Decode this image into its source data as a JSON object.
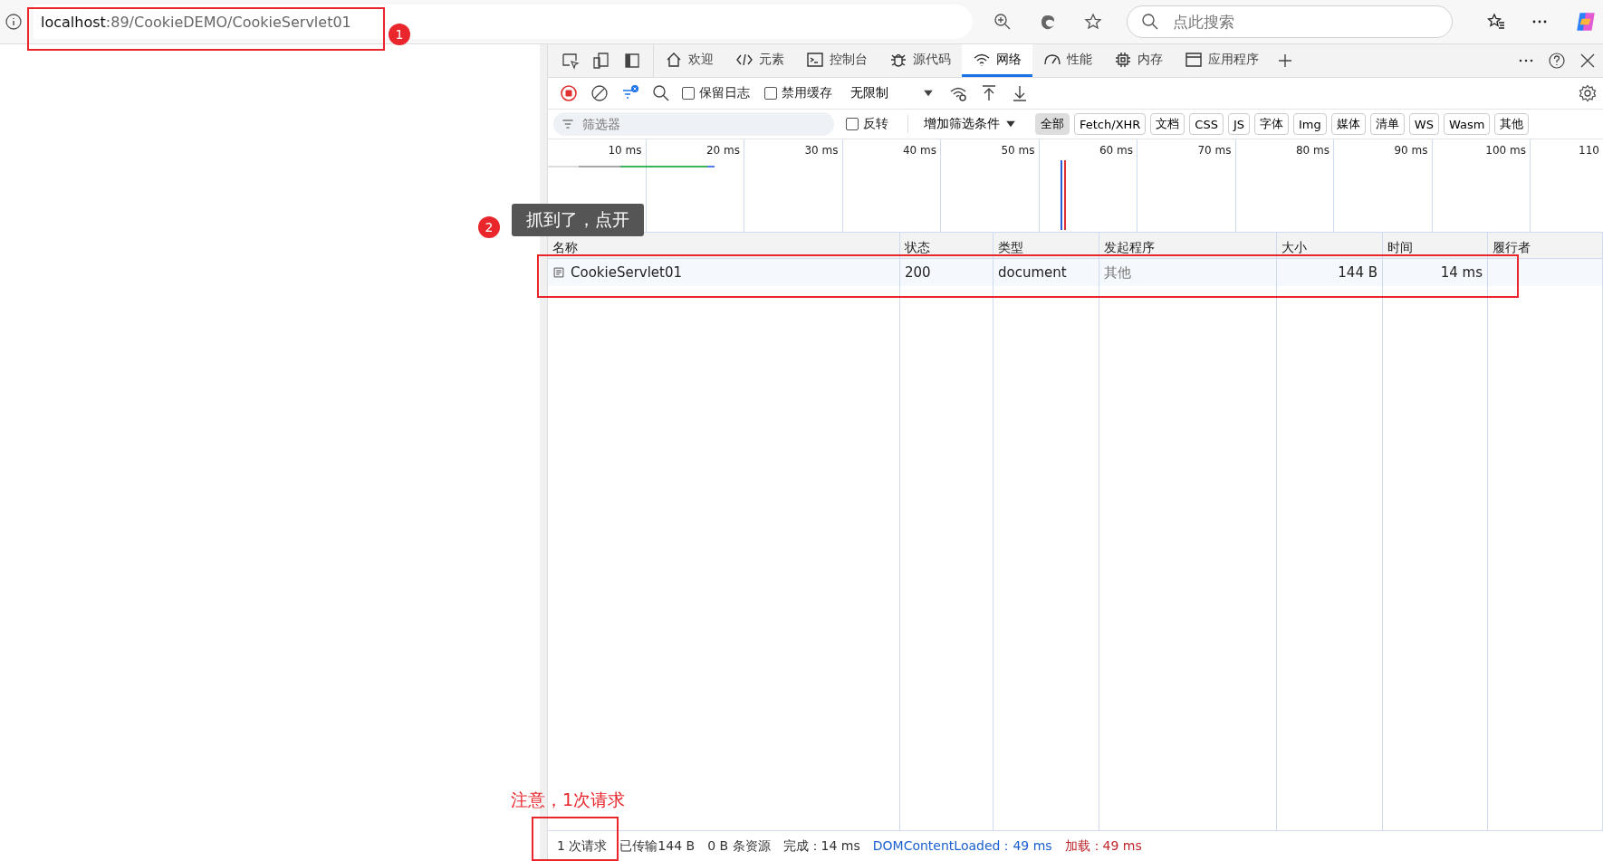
{
  "address_bar": {
    "host": "localhost",
    "path": ":89/CookieDEMO/CookieServlet01"
  },
  "search": {
    "placeholder": "点此搜索"
  },
  "devtools": {
    "tabs": [
      {
        "label": "欢迎",
        "selected": false
      },
      {
        "label": "元素",
        "selected": false
      },
      {
        "label": "控制台",
        "selected": false
      },
      {
        "label": "源代码",
        "selected": false
      },
      {
        "label": "网络",
        "selected": true
      },
      {
        "label": "性能",
        "selected": false
      },
      {
        "label": "内存",
        "selected": false
      },
      {
        "label": "应用程序",
        "selected": false
      }
    ],
    "checkboxes": [
      {
        "label": "保留日志",
        "checked": false
      },
      {
        "label": "禁用缓存",
        "checked": false
      }
    ],
    "throttle": "无限制",
    "filter": {
      "placeholder": "筛选器"
    },
    "invert": {
      "label": "反转",
      "checked": false
    },
    "more_filters": "增加筛选条件",
    "type_filters": [
      {
        "label": "全部",
        "selected": true
      },
      {
        "label": "Fetch/XHR",
        "selected": false
      },
      {
        "label": "文档",
        "selected": false
      },
      {
        "label": "CSS",
        "selected": false
      },
      {
        "label": "JS",
        "selected": false
      },
      {
        "label": "字体",
        "selected": false
      },
      {
        "label": "Img",
        "selected": false
      },
      {
        "label": "媒体",
        "selected": false
      },
      {
        "label": "清单",
        "selected": false
      },
      {
        "label": "WS",
        "selected": false
      },
      {
        "label": "Wasm",
        "selected": false
      },
      {
        "label": "其他",
        "selected": false
      }
    ]
  },
  "timeline": {
    "ticks": [
      "10 ms",
      "20 ms",
      "30 ms",
      "40 ms",
      "50 ms",
      "60 ms",
      "70 ms",
      "80 ms",
      "90 ms",
      "100 ms",
      "110"
    ]
  },
  "table": {
    "columns": [
      "名称",
      "状态",
      "类型",
      "发起程序",
      "大小",
      "时间",
      "履行者"
    ],
    "rows": [
      {
        "name": "CookieServlet01",
        "status": "200",
        "type": "document",
        "initiator": "其他",
        "size": "144 B",
        "time": "14 ms"
      }
    ]
  },
  "status_bar": [
    {
      "text": "1 次请求",
      "kind": "plain"
    },
    {
      "text": "已传输144 B",
      "kind": "plain"
    },
    {
      "text": "0 B 条资源",
      "kind": "plain"
    },
    {
      "text": "完成：14 ms",
      "kind": "plain"
    },
    {
      "text": "DOMContentLoaded：49 ms",
      "kind": "dom"
    },
    {
      "text": "加载：49 ms",
      "kind": "load"
    }
  ],
  "annotations": {
    "url_badge": "1",
    "tooltip_badge": "2",
    "tooltip": "抓到了，点开",
    "note": "注意，1次请求"
  }
}
